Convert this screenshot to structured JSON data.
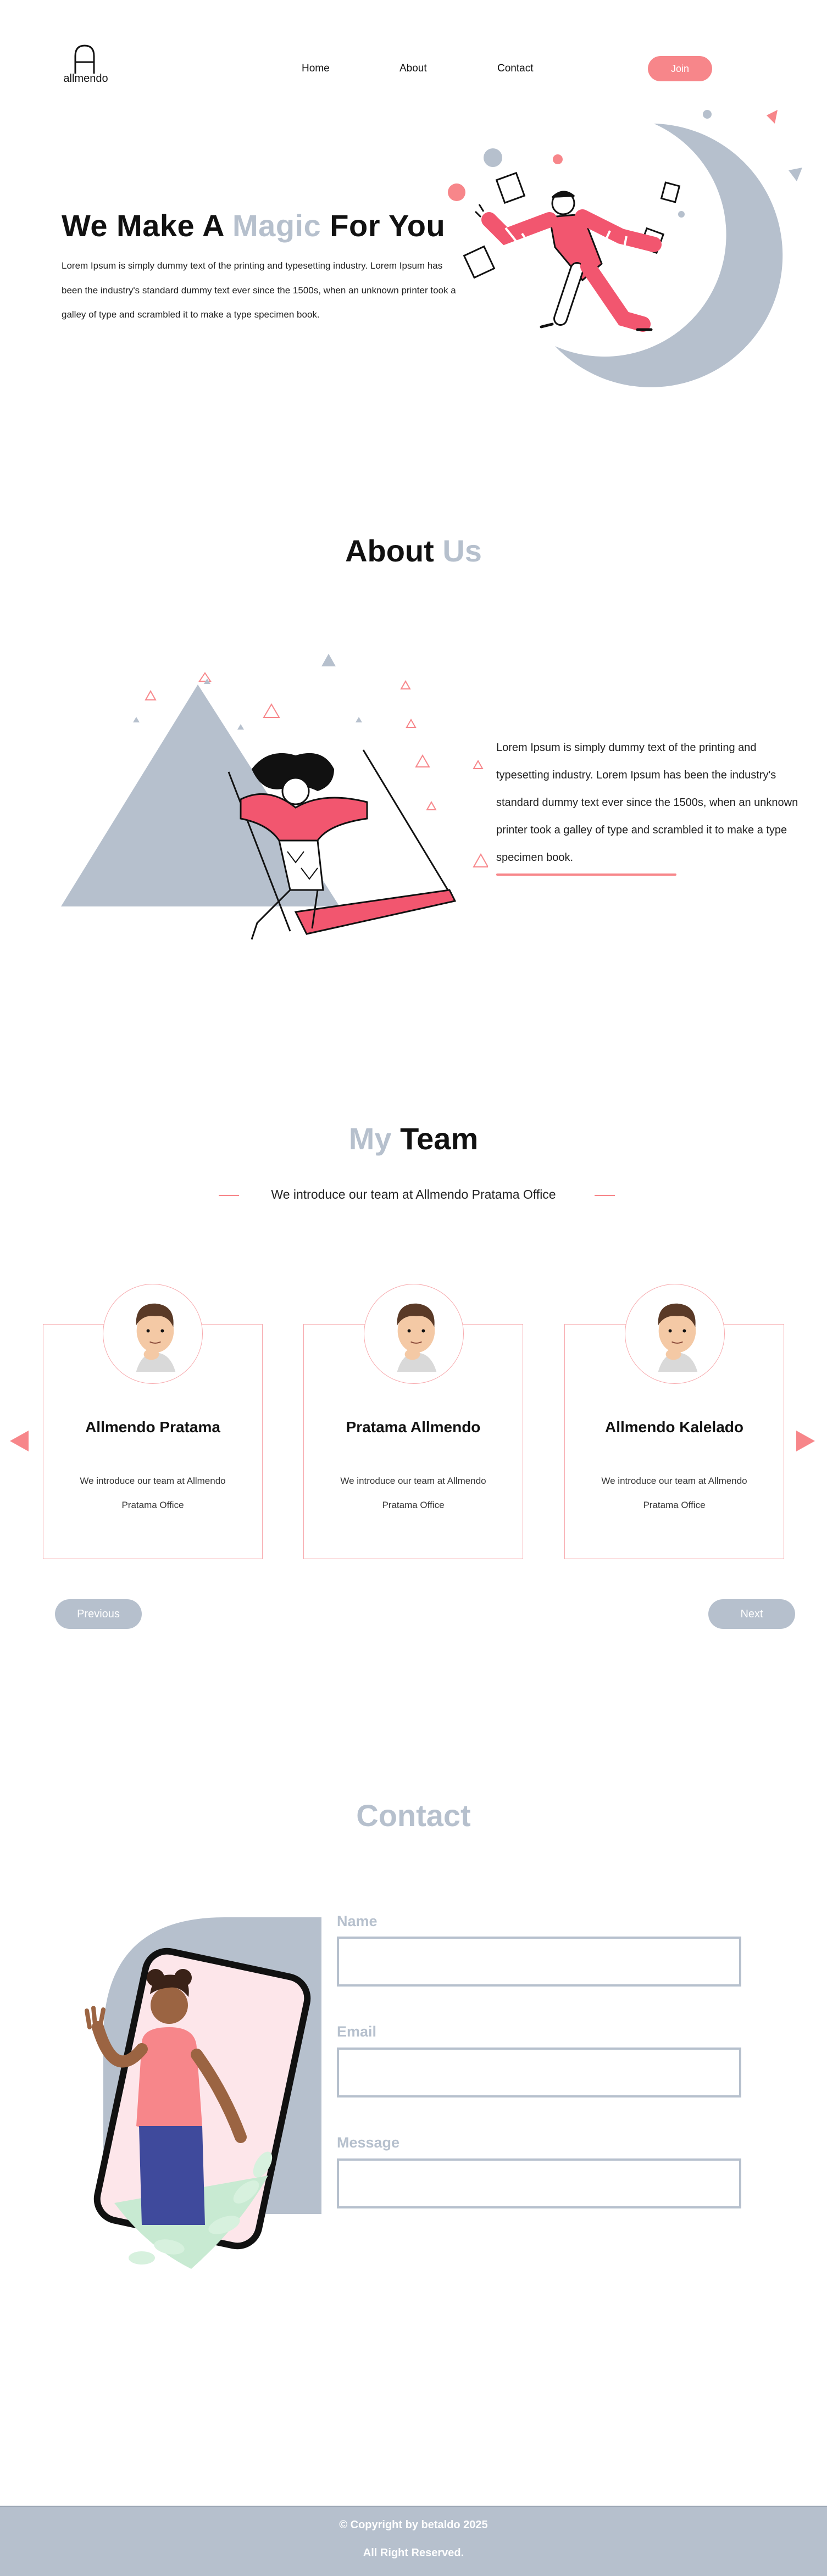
{
  "nav": {
    "logo_text": "allmendo",
    "links": [
      {
        "label": "Home"
      },
      {
        "label": "About"
      },
      {
        "label": "Contact"
      }
    ],
    "join_label": "Join",
    "accent": "#f7868a"
  },
  "hero": {
    "title_pre": "We Make A ",
    "title_highlight": "Magic",
    "title_post": " For You",
    "text": "Lorem Ipsum is simply dummy text of the printing and typesetting industry. Lorem Ipsum has been the industry's standard dummy text ever since the 1500s, when an unknown printer took a galley of type and scrambled it to make a type specimen book.",
    "illustration_icon": "dancing-man-moon-illustration"
  },
  "about": {
    "title_pre": "About ",
    "title_highlight": "Us",
    "text": "Lorem Ipsum is simply dummy text of the printing and typesetting industry. Lorem Ipsum has been the industry's standard dummy text ever since the 1500s, when an unknown printer took a galley of type and scrambled it to make a type specimen book.",
    "illustration_icon": "girl-on-swing-illustration"
  },
  "team": {
    "title_pre": "My ",
    "title_post": "Team",
    "subtitle": "We introduce our team at Allmendo Pratama Office",
    "members": [
      {
        "name": "Allmendo Pratama",
        "description": "We introduce our team at Allmendo Pratama Office",
        "avatar_icon": "thinking-man-avatar"
      },
      {
        "name": "Pratama Allmendo",
        "description": "We introduce our team at Allmendo Pratama Office",
        "avatar_icon": "thinking-man-avatar"
      },
      {
        "name": "Allmendo Kalelado",
        "description": "We introduce our team at Allmendo Pratama Office",
        "avatar_icon": "thinking-man-avatar"
      }
    ],
    "previous_label": "Previous",
    "next_label": "Next"
  },
  "contact": {
    "title": "Contact",
    "fields": {
      "name_label": "Name",
      "name_value": "",
      "email_label": "Email",
      "email_value": "",
      "message_label": "Message",
      "message_value": ""
    },
    "illustration_icon": "woman-waving-phone-illustration"
  },
  "footer": {
    "copyright": "© Copyright by betaldo 2025",
    "rights": "All Right Reserved."
  },
  "colors": {
    "accent": "#f7868a",
    "muted": "#b6c0cd",
    "pink_fill": "#f2566f"
  }
}
